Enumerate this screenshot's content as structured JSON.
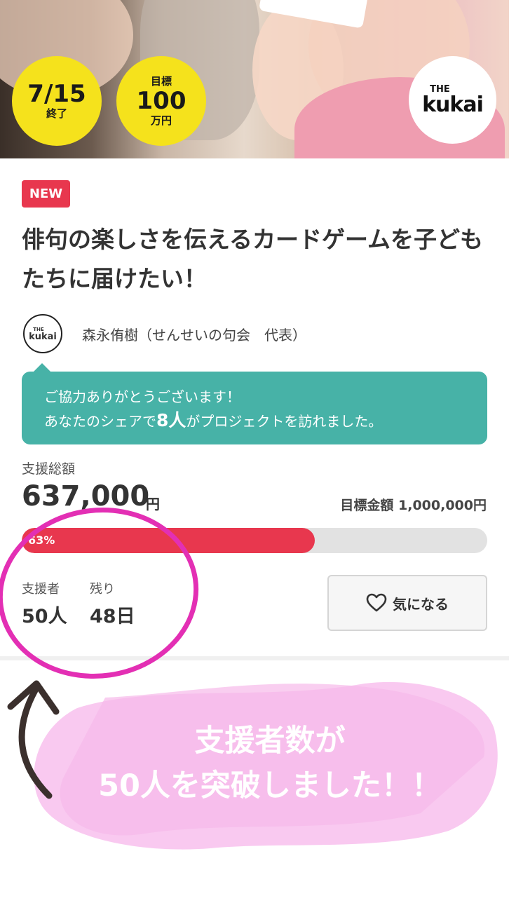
{
  "hero": {
    "badge_date": {
      "date": "7/15",
      "label": "終了"
    },
    "badge_goal": {
      "label_top": "目標",
      "amount": "100",
      "unit": "万円"
    },
    "logo": {
      "the": "THE",
      "name": "kukai"
    }
  },
  "project": {
    "new_badge": "NEW",
    "title": "俳句の楽しさを伝えるカードゲームを子どもたちに届けたい！",
    "owner": {
      "logo_the": "THE",
      "logo_name": "kukai",
      "name": "森永侑樹（せんせいの句会　代表）"
    }
  },
  "share_message": {
    "line1": "ご協力ありがとうございます！",
    "line2_prefix": "あなたのシェアで",
    "count": "8人",
    "line2_suffix": "がプロジェクトを訪れました。"
  },
  "funding": {
    "total_label": "支援総額",
    "total_amount": "637,000",
    "currency": "円",
    "goal_text": "目標金額 1,000,000円",
    "progress_percent": 63,
    "progress_label": "63%",
    "supporters_label": "支援者",
    "supporters_value": "50人",
    "remaining_label": "残り",
    "remaining_value": "48日"
  },
  "actions": {
    "favorite_label": "気になる",
    "favorite_icon": "heart-icon"
  },
  "announcement": {
    "text": "支援者数が\n50人を突破しました！！"
  },
  "colors": {
    "accent_red": "#e8374e",
    "teal": "#47b2a7",
    "badge_yellow": "#f5e21c",
    "annotation_magenta": "#e32fb4",
    "annotation_pink": "#f9c6ef",
    "arrow_brown": "#3b302d"
  }
}
